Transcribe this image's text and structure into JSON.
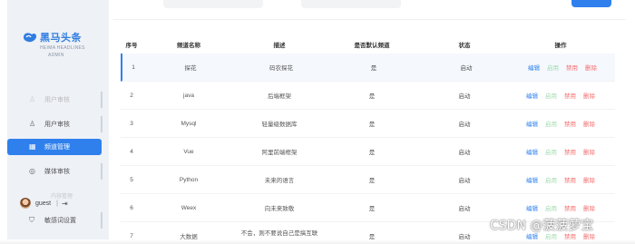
{
  "brand": {
    "title": "黑马头条",
    "subtitle": "HEIMA HEADLINES",
    "subtitle2": "ADMIN",
    "accent": "#2f80ed"
  },
  "sidebar": {
    "items": [
      {
        "label": "用户审核",
        "icon": "users-icon",
        "state": "faded"
      },
      {
        "label": "用户审核",
        "icon": "user-check-icon",
        "state": "normal"
      },
      {
        "label": "频道管理",
        "icon": "grid-icon",
        "state": "active"
      },
      {
        "label": "媒体审核",
        "icon": "media-icon",
        "state": "normal"
      },
      {
        "label": "敏感词设置",
        "icon": "shield-icon",
        "state": "normal"
      }
    ],
    "overlay_label": "内容管理",
    "user": {
      "name": "guest",
      "separator": "|",
      "logout_icon": "logout-icon"
    }
  },
  "table": {
    "headers": [
      "序号",
      "频道名称",
      "描述",
      "是否默认频道",
      "状态",
      "操作"
    ],
    "rows": [
      {
        "index": "1",
        "name": "探花",
        "desc": "码农探花",
        "default": "是",
        "status": "启动"
      },
      {
        "index": "2",
        "name": "java",
        "desc": "后端框架",
        "default": "是",
        "status": "启动"
      },
      {
        "index": "3",
        "name": "Mysql",
        "desc": "轻量级数据库",
        "default": "是",
        "status": "启动"
      },
      {
        "index": "4",
        "name": "Vue",
        "desc": "阿里前端框架",
        "default": "是",
        "status": "启动"
      },
      {
        "index": "5",
        "name": "Python",
        "desc": "未来的语言",
        "default": "是",
        "status": "启动"
      },
      {
        "index": "6",
        "name": "Weex",
        "desc": "向未来致敬",
        "default": "是",
        "status": "启动"
      },
      {
        "index": "7",
        "name": "大数据",
        "desc": "不会，则不要说自己是搞互联",
        "default": "是",
        "status": "启动"
      }
    ],
    "actions": {
      "edit": "编辑",
      "enable": "启用",
      "disable": "禁用",
      "delete": "删除"
    }
  },
  "watermark": "CSDN @菠菠萝宝"
}
